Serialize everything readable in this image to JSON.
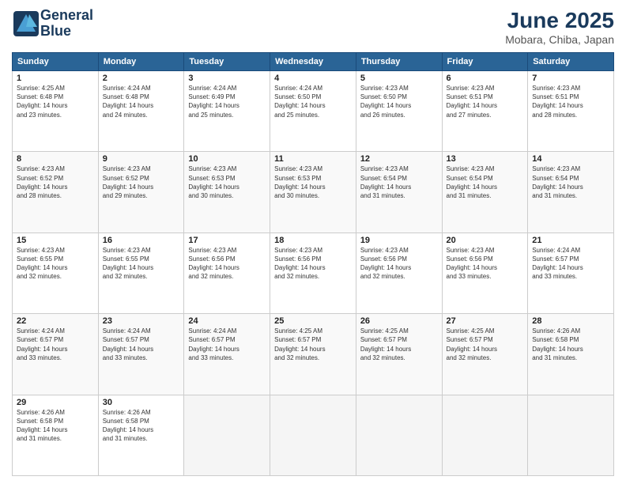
{
  "logo": {
    "line1": "General",
    "line2": "Blue"
  },
  "title": "June 2025",
  "subtitle": "Mobara, Chiba, Japan",
  "days_of_week": [
    "Sunday",
    "Monday",
    "Tuesday",
    "Wednesday",
    "Thursday",
    "Friday",
    "Saturday"
  ],
  "weeks": [
    [
      {
        "day": "1",
        "info": "Sunrise: 4:25 AM\nSunset: 6:48 PM\nDaylight: 14 hours\nand 23 minutes."
      },
      {
        "day": "2",
        "info": "Sunrise: 4:24 AM\nSunset: 6:48 PM\nDaylight: 14 hours\nand 24 minutes."
      },
      {
        "day": "3",
        "info": "Sunrise: 4:24 AM\nSunset: 6:49 PM\nDaylight: 14 hours\nand 25 minutes."
      },
      {
        "day": "4",
        "info": "Sunrise: 4:24 AM\nSunset: 6:50 PM\nDaylight: 14 hours\nand 25 minutes."
      },
      {
        "day": "5",
        "info": "Sunrise: 4:23 AM\nSunset: 6:50 PM\nDaylight: 14 hours\nand 26 minutes."
      },
      {
        "day": "6",
        "info": "Sunrise: 4:23 AM\nSunset: 6:51 PM\nDaylight: 14 hours\nand 27 minutes."
      },
      {
        "day": "7",
        "info": "Sunrise: 4:23 AM\nSunset: 6:51 PM\nDaylight: 14 hours\nand 28 minutes."
      }
    ],
    [
      {
        "day": "8",
        "info": "Sunrise: 4:23 AM\nSunset: 6:52 PM\nDaylight: 14 hours\nand 28 minutes."
      },
      {
        "day": "9",
        "info": "Sunrise: 4:23 AM\nSunset: 6:52 PM\nDaylight: 14 hours\nand 29 minutes."
      },
      {
        "day": "10",
        "info": "Sunrise: 4:23 AM\nSunset: 6:53 PM\nDaylight: 14 hours\nand 30 minutes."
      },
      {
        "day": "11",
        "info": "Sunrise: 4:23 AM\nSunset: 6:53 PM\nDaylight: 14 hours\nand 30 minutes."
      },
      {
        "day": "12",
        "info": "Sunrise: 4:23 AM\nSunset: 6:54 PM\nDaylight: 14 hours\nand 31 minutes."
      },
      {
        "day": "13",
        "info": "Sunrise: 4:23 AM\nSunset: 6:54 PM\nDaylight: 14 hours\nand 31 minutes."
      },
      {
        "day": "14",
        "info": "Sunrise: 4:23 AM\nSunset: 6:54 PM\nDaylight: 14 hours\nand 31 minutes."
      }
    ],
    [
      {
        "day": "15",
        "info": "Sunrise: 4:23 AM\nSunset: 6:55 PM\nDaylight: 14 hours\nand 32 minutes."
      },
      {
        "day": "16",
        "info": "Sunrise: 4:23 AM\nSunset: 6:55 PM\nDaylight: 14 hours\nand 32 minutes."
      },
      {
        "day": "17",
        "info": "Sunrise: 4:23 AM\nSunset: 6:56 PM\nDaylight: 14 hours\nand 32 minutes."
      },
      {
        "day": "18",
        "info": "Sunrise: 4:23 AM\nSunset: 6:56 PM\nDaylight: 14 hours\nand 32 minutes."
      },
      {
        "day": "19",
        "info": "Sunrise: 4:23 AM\nSunset: 6:56 PM\nDaylight: 14 hours\nand 32 minutes."
      },
      {
        "day": "20",
        "info": "Sunrise: 4:23 AM\nSunset: 6:56 PM\nDaylight: 14 hours\nand 33 minutes."
      },
      {
        "day": "21",
        "info": "Sunrise: 4:24 AM\nSunset: 6:57 PM\nDaylight: 14 hours\nand 33 minutes."
      }
    ],
    [
      {
        "day": "22",
        "info": "Sunrise: 4:24 AM\nSunset: 6:57 PM\nDaylight: 14 hours\nand 33 minutes."
      },
      {
        "day": "23",
        "info": "Sunrise: 4:24 AM\nSunset: 6:57 PM\nDaylight: 14 hours\nand 33 minutes."
      },
      {
        "day": "24",
        "info": "Sunrise: 4:24 AM\nSunset: 6:57 PM\nDaylight: 14 hours\nand 33 minutes."
      },
      {
        "day": "25",
        "info": "Sunrise: 4:25 AM\nSunset: 6:57 PM\nDaylight: 14 hours\nand 32 minutes."
      },
      {
        "day": "26",
        "info": "Sunrise: 4:25 AM\nSunset: 6:57 PM\nDaylight: 14 hours\nand 32 minutes."
      },
      {
        "day": "27",
        "info": "Sunrise: 4:25 AM\nSunset: 6:57 PM\nDaylight: 14 hours\nand 32 minutes."
      },
      {
        "day": "28",
        "info": "Sunrise: 4:26 AM\nSunset: 6:58 PM\nDaylight: 14 hours\nand 31 minutes."
      }
    ],
    [
      {
        "day": "29",
        "info": "Sunrise: 4:26 AM\nSunset: 6:58 PM\nDaylight: 14 hours\nand 31 minutes."
      },
      {
        "day": "30",
        "info": "Sunrise: 4:26 AM\nSunset: 6:58 PM\nDaylight: 14 hours\nand 31 minutes."
      },
      {
        "day": "",
        "info": ""
      },
      {
        "day": "",
        "info": ""
      },
      {
        "day": "",
        "info": ""
      },
      {
        "day": "",
        "info": ""
      },
      {
        "day": "",
        "info": ""
      }
    ]
  ]
}
